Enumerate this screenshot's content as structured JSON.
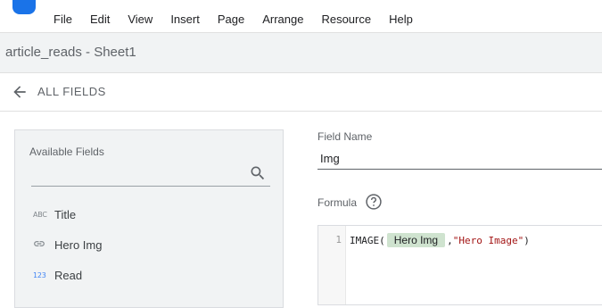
{
  "menu": [
    "File",
    "Edit",
    "View",
    "Insert",
    "Page",
    "Arrange",
    "Resource",
    "Help"
  ],
  "datasource": {
    "name": "article_reads - Sheet1"
  },
  "nav": {
    "back_label": "ALL FIELDS"
  },
  "available_fields": {
    "title": "Available Fields",
    "items": [
      {
        "type_badge": "ABC",
        "label": "Title"
      },
      {
        "type_icon": "link-icon",
        "label": "Hero Img"
      },
      {
        "type_badge": "123",
        "label": "Read"
      }
    ]
  },
  "field_editor": {
    "name_label": "Field Name",
    "name_value": "Img",
    "formula_label": "Formula",
    "line_number": "1",
    "formula": {
      "fn": "IMAGE(",
      "field_chip": "Hero Img",
      "sep": ", ",
      "string_arg": "\"Hero Image\"",
      "close": ")"
    }
  },
  "colors": {
    "accent": "#1a73e8",
    "chip": "#cfe3cf",
    "string": "#a31515"
  }
}
